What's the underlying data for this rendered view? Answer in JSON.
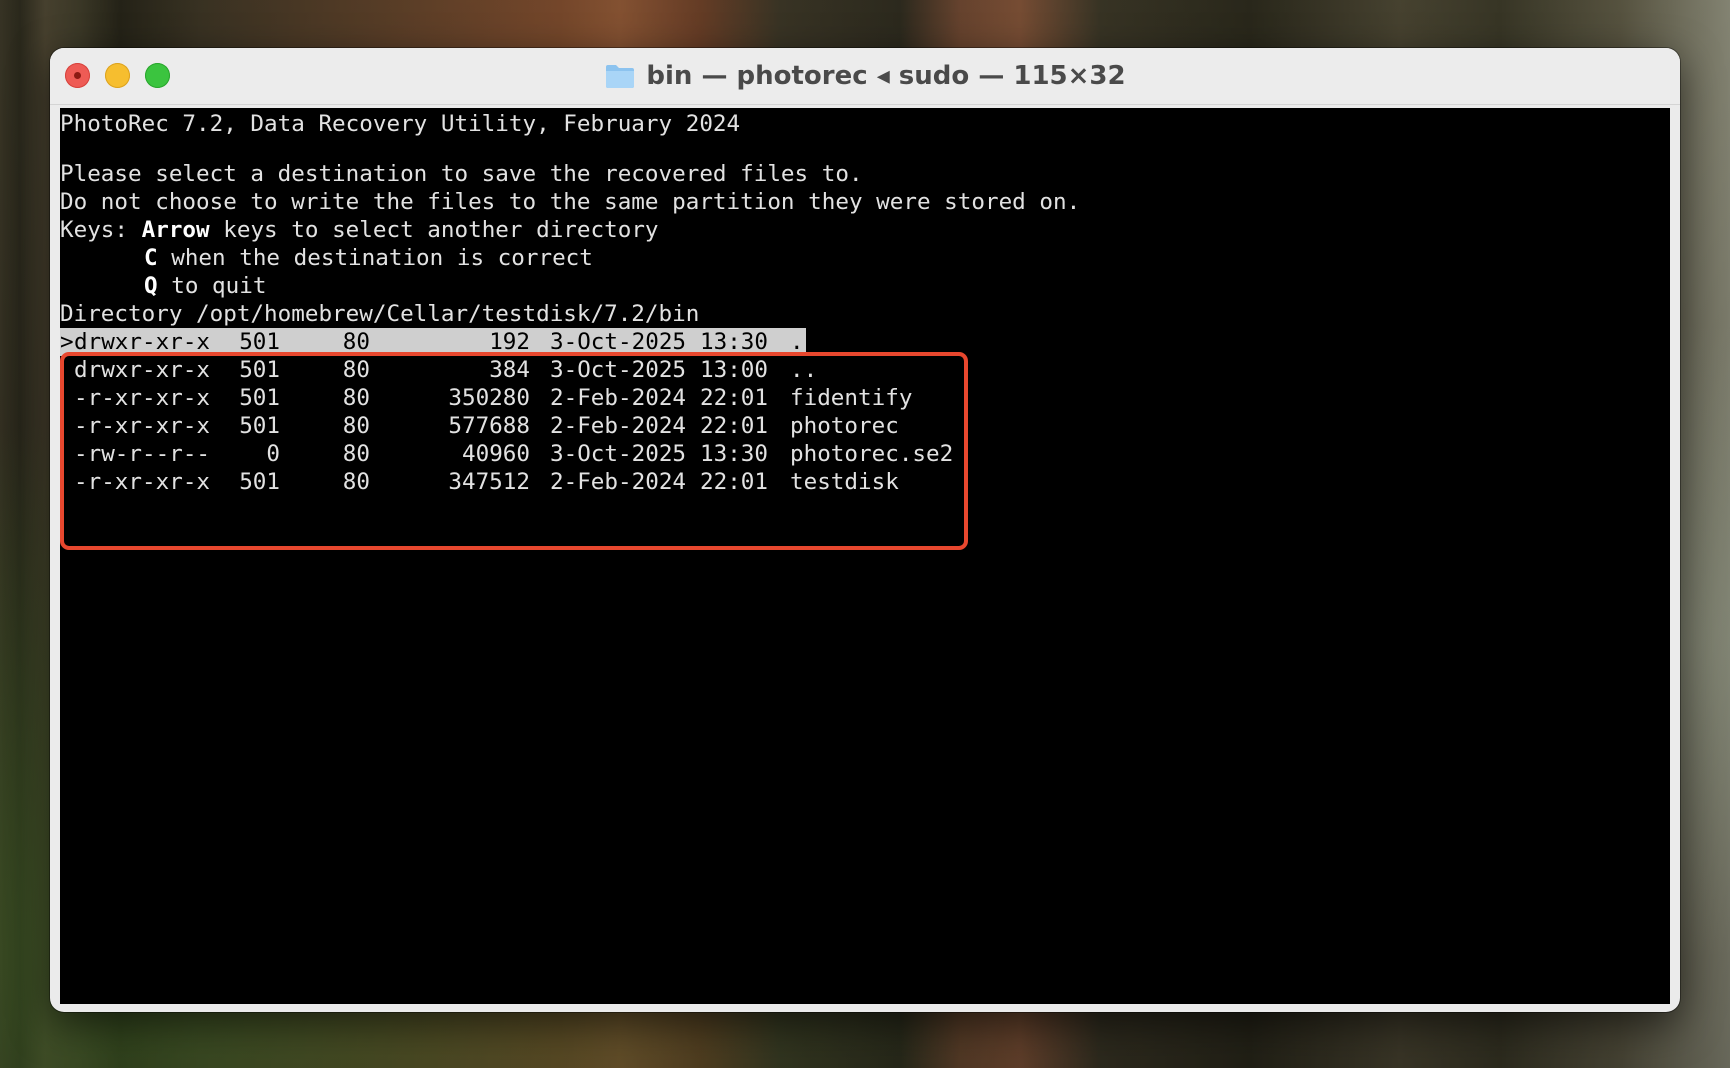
{
  "window": {
    "title": "bin — photorec ◂ sudo — 115×32",
    "folder_icon": "folder-icon"
  },
  "terminal": {
    "header": "PhotoRec 7.2, Data Recovery Utility, February 2024",
    "prompt_line1": "Please select a destination to save the recovered files to.",
    "prompt_line2": "Do not choose to write the files to the same partition they were stored on.",
    "keys_prefix": "Keys: ",
    "keys_arrow": "Arrow",
    "keys_arrow_text": " keys to select another directory",
    "keys_c": "C",
    "keys_c_text": " when the destination is correct",
    "keys_q": "Q",
    "keys_q_text": " to quit",
    "directory_line": "Directory /opt/homebrew/Cellar/testdisk/7.2/bin",
    "selected_index": 0,
    "cursor": ">",
    "rows": [
      {
        "perms": "drwxr-xr-x",
        "uid": "501",
        "gid": "80",
        "size": "192",
        "date": "3-Oct-2025",
        "time": "13:30",
        "name": "."
      },
      {
        "perms": "drwxr-xr-x",
        "uid": "501",
        "gid": "80",
        "size": "384",
        "date": "3-Oct-2025",
        "time": "13:00",
        "name": ".."
      },
      {
        "perms": "-r-xr-xr-x",
        "uid": "501",
        "gid": "80",
        "size": "350280",
        "date": "2-Feb-2024",
        "time": "22:01",
        "name": "fidentify"
      },
      {
        "perms": "-r-xr-xr-x",
        "uid": "501",
        "gid": "80",
        "size": "577688",
        "date": "2-Feb-2024",
        "time": "22:01",
        "name": "photorec"
      },
      {
        "perms": "-rw-r--r--",
        "uid": "0",
        "gid": "80",
        "size": "40960",
        "date": "3-Oct-2025",
        "time": "13:30",
        "name": "photorec.se2"
      },
      {
        "perms": "-r-xr-xr-x",
        "uid": "501",
        "gid": "80",
        "size": "347512",
        "date": "2-Feb-2024",
        "time": "22:01",
        "name": "testdisk"
      }
    ]
  },
  "colors": {
    "terminal_bg": "#000000",
    "terminal_fg": "#e2e2e2",
    "selection_bg": "#cfcfcf",
    "annotation_box": "#e8472e"
  }
}
